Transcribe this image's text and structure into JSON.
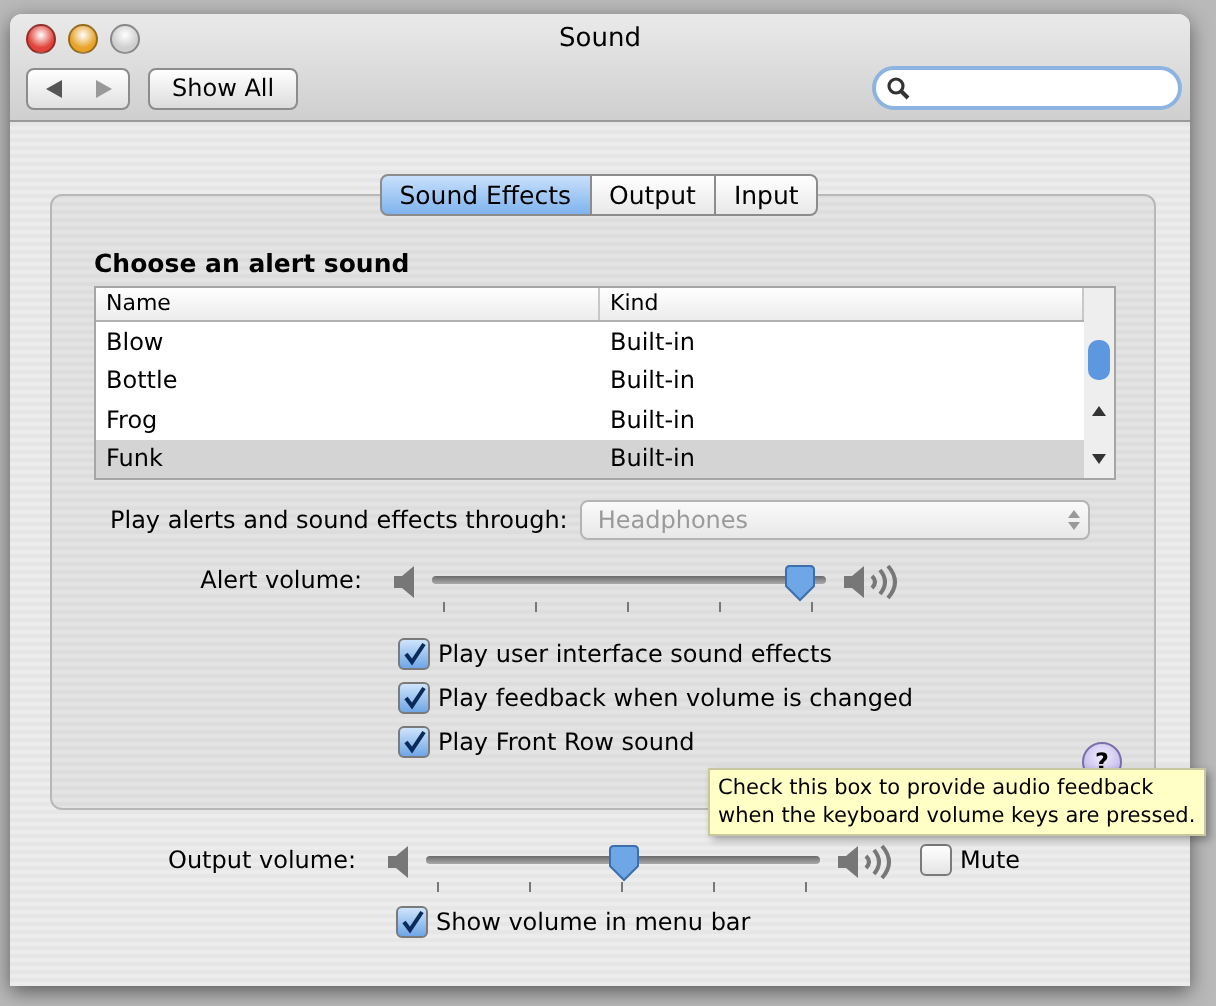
{
  "window": {
    "title": "Sound"
  },
  "toolbar": {
    "show_all": "Show All"
  },
  "tabs": [
    {
      "label": "Sound Effects",
      "selected": true
    },
    {
      "label": "Output",
      "selected": false
    },
    {
      "label": "Input",
      "selected": false
    }
  ],
  "alert_sound": {
    "heading": "Choose an alert sound",
    "columns": [
      "Name",
      "Kind"
    ],
    "rows": [
      {
        "name": "Blow",
        "kind": "Built-in",
        "selected": false
      },
      {
        "name": "Bottle",
        "kind": "Built-in",
        "selected": false
      },
      {
        "name": "Frog",
        "kind": "Built-in",
        "selected": false
      },
      {
        "name": "Funk",
        "kind": "Built-in",
        "selected": true
      }
    ]
  },
  "play_through": {
    "label": "Play alerts and sound effects through:",
    "value": "Headphones",
    "disabled": true
  },
  "alert_volume": {
    "label": "Alert volume:",
    "level": 0.97
  },
  "options": [
    {
      "label": "Play user interface sound effects",
      "checked": true
    },
    {
      "label": "Play feedback when volume is changed",
      "checked": true
    },
    {
      "label": "Play Front Row sound",
      "checked": true
    }
  ],
  "help": "?",
  "tooltip": {
    "lines": [
      "Check this box to provide audio feedback",
      "when the keyboard volume keys are pressed."
    ]
  },
  "output_volume": {
    "label": "Output volume:",
    "level": 0.5,
    "mute": {
      "label": "Mute",
      "checked": false
    }
  },
  "show_volume": {
    "label": "Show volume in menu bar",
    "checked": true
  }
}
